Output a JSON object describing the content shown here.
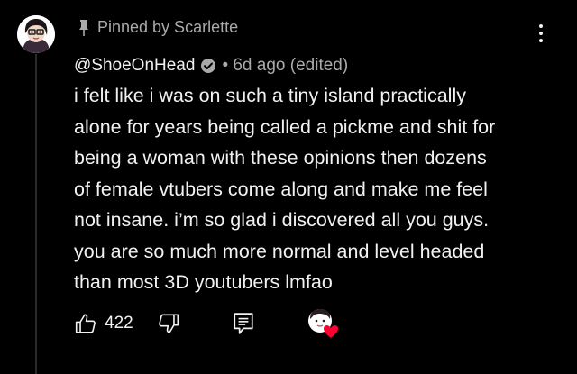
{
  "comment": {
    "pinned_label": "Pinned by Scarlette",
    "author": "@ShoeOnHead",
    "meta": "• 6d ago (edited)",
    "body_lines": [
      "i felt like i was on such a tiny island practically",
      "alone for years being called a pickme and shit for",
      "being a woman with these opinions then dozens",
      "of female vtubers come along and make me feel",
      "not insane. i’m so glad i discovered all you guys.",
      "you are so much more normal and level headed",
      "than most 3D youtubers lmfao"
    ],
    "like_count": "422"
  },
  "icons": {
    "pin": "pin-icon",
    "verified": "verified-check-icon",
    "more": "more-vertical-icon",
    "like": "thumbs-up-icon",
    "dislike": "thumbs-down-icon",
    "reply": "reply-icon",
    "heart": "creator-heart-icon"
  },
  "colors": {
    "background": "#000000",
    "text": "#f1f1f1",
    "muted": "#aaaaaa",
    "heart": "#ff0033"
  }
}
